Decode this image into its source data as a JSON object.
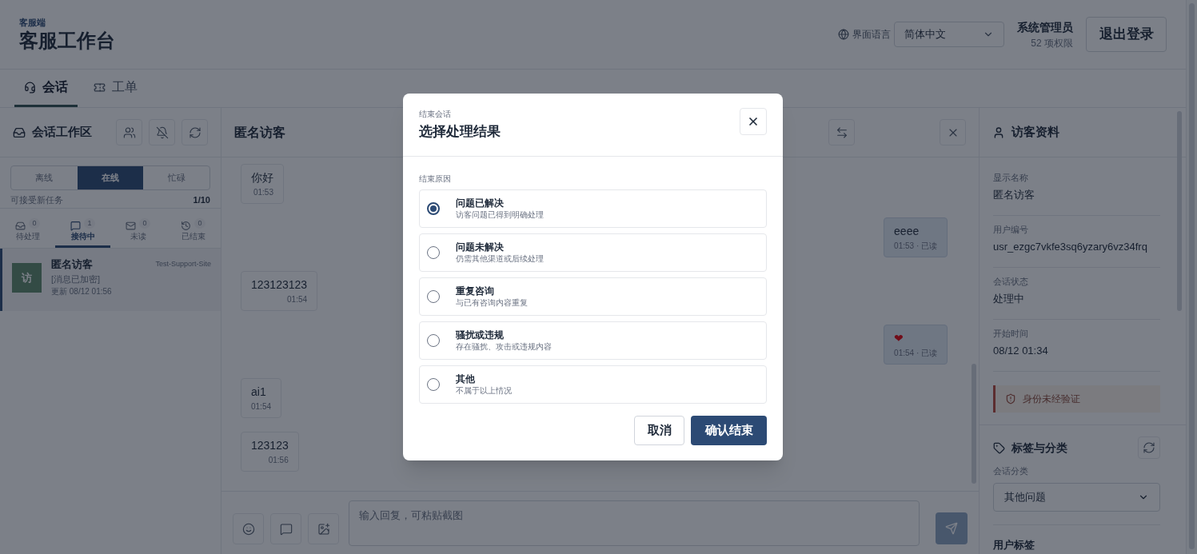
{
  "header": {
    "eyebrow": "客服端",
    "title": "客服工作台",
    "language_label": "界面语言",
    "language_value": "简体中文",
    "user_name": "系统管理员",
    "user_permissions": "52 项权限",
    "logout": "退出登录"
  },
  "main_tabs": [
    {
      "label": "会话",
      "selected": true
    },
    {
      "label": "工单",
      "selected": false
    }
  ],
  "workspace": {
    "title": "会话工作区",
    "status_options": [
      {
        "label": "离线",
        "selected": false
      },
      {
        "label": "在线",
        "selected": true
      },
      {
        "label": "忙碌",
        "selected": false
      }
    ],
    "capacity_label": "可接受新任务",
    "capacity_value": "1/10",
    "queue_tabs": [
      {
        "label": "待处理",
        "count": "0",
        "selected": false
      },
      {
        "label": "接待中",
        "count": "1",
        "selected": true
      },
      {
        "label": "未读",
        "count": "0",
        "selected": false
      },
      {
        "label": "已结束",
        "count": "0",
        "selected": false
      }
    ],
    "conversations": [
      {
        "avatar": "访",
        "name": "匿名访客",
        "site": "Test-Support-Site",
        "preview": "[消息已加密]",
        "updated": "更新 08/12 01:56",
        "selected": true
      }
    ]
  },
  "chat": {
    "title": "匿名访客",
    "messages": [
      {
        "kind": "received",
        "text": "你好",
        "time": "01:53"
      },
      {
        "kind": "sent",
        "text": "eeee",
        "time": "01:53 · 已读"
      },
      {
        "kind": "received",
        "text": "123123123",
        "time": "01:54"
      },
      {
        "kind": "sent",
        "text": "❤",
        "time": "01:54 · 已读"
      },
      {
        "kind": "received",
        "text": "ai1",
        "time": "01:54"
      },
      {
        "kind": "received",
        "text": "123123",
        "time": "01:56"
      }
    ],
    "input_placeholder": "输入回复，可粘贴截图"
  },
  "visitor_panel": {
    "title": "访客资料",
    "fields": [
      {
        "label": "显示名称",
        "value": "匿名访客"
      },
      {
        "label": "用户编号",
        "value": "usr_ezgc7vkfe3sq6yzary6vz34frq"
      },
      {
        "label": "会话状态",
        "value": "处理中"
      },
      {
        "label": "开始时间",
        "value": "08/12 01:34"
      }
    ],
    "warning": "身份未经验证",
    "tags_title": "标签与分类",
    "category_label": "会话分类",
    "category_value": "其他问题",
    "user_tags_title": "用户标签"
  },
  "dialog": {
    "eyebrow": "结束会话",
    "title": "选择处理结果",
    "reason_label": "结束原因",
    "reasons": [
      {
        "title": "问题已解决",
        "description": "访客问题已得到明确处理",
        "selected": true
      },
      {
        "title": "问题未解决",
        "description": "仍需其他渠道或后续处理",
        "selected": false
      },
      {
        "title": "重复咨询",
        "description": "与已有咨询内容重复",
        "selected": false
      },
      {
        "title": "骚扰或违规",
        "description": "存在骚扰、攻击或违规内容",
        "selected": false
      },
      {
        "title": "其他",
        "description": "不属于以上情况",
        "selected": false
      }
    ],
    "cancel": "取消",
    "confirm": "确认结束"
  }
}
